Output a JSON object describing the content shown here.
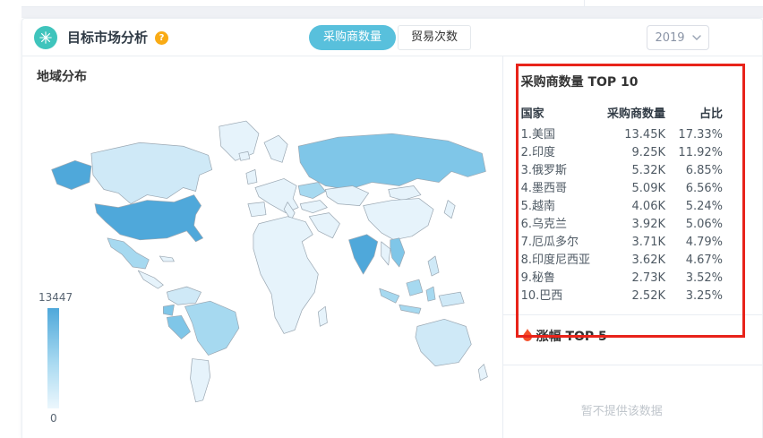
{
  "colors": {
    "icon_teal": "#3fc4bc",
    "tab_active_bg": "#58c0dc",
    "help_icon_bg": "#f9ab15",
    "flame": "#f4502a",
    "annotation_red": "#e8231a"
  },
  "map_colors": {
    "v0": "#e6f3fb",
    "v1": "#cfe9f7",
    "v2": "#a6d9f0",
    "v3": "#7fc6e8",
    "v4": "#4fa8da"
  },
  "header": {
    "title": "目标市场分析",
    "help_glyph": "?",
    "tabs": [
      {
        "label": "采购商数量"
      },
      {
        "label": "贸易次数"
      }
    ],
    "year": "2019"
  },
  "map_panel": {
    "title": "地域分布",
    "legend_max": "13447",
    "legend_min": "0"
  },
  "right_panel": {
    "top10_title": "采购商数量 TOP 10",
    "columns": {
      "country": "国家",
      "count": "采购商数量",
      "share": "占比"
    },
    "rows": [
      {
        "name": "1.美国",
        "count": "13.45K",
        "share": "17.33%"
      },
      {
        "name": "2.印度",
        "count": "9.25K",
        "share": "11.92%"
      },
      {
        "name": "3.俄罗斯",
        "count": "5.32K",
        "share": "6.85%"
      },
      {
        "name": "4.墨西哥",
        "count": "5.09K",
        "share": "6.56%"
      },
      {
        "name": "5.越南",
        "count": "4.06K",
        "share": "5.24%"
      },
      {
        "name": "6.乌克兰",
        "count": "3.92K",
        "share": "5.06%"
      },
      {
        "name": "7.厄瓜多尔",
        "count": "3.71K",
        "share": "4.79%"
      },
      {
        "name": "8.印度尼西亚",
        "count": "3.62K",
        "share": "4.67%"
      },
      {
        "name": "9.秘鲁",
        "count": "2.73K",
        "share": "3.52%"
      },
      {
        "name": "10.巴西",
        "count": "2.52K",
        "share": "3.25%"
      }
    ],
    "gains_title": "涨幅 TOP 5",
    "empty_text": "暂不提供该数据"
  },
  "chart_data": {
    "type": "choropleth-map",
    "title": "地域分布",
    "metric": "采购商数量",
    "year": "2019",
    "legend_range": [
      0,
      13447
    ],
    "legend_position": "bottom-left",
    "series": [
      {
        "country": "美国",
        "value": 13447,
        "count_label": "13.45K",
        "share": "17.33%"
      },
      {
        "country": "印度",
        "value": 9250,
        "count_label": "9.25K",
        "share": "11.92%"
      },
      {
        "country": "俄罗斯",
        "value": 5320,
        "count_label": "5.32K",
        "share": "6.85%"
      },
      {
        "country": "墨西哥",
        "value": 5090,
        "count_label": "5.09K",
        "share": "6.56%"
      },
      {
        "country": "越南",
        "value": 4060,
        "count_label": "4.06K",
        "share": "5.24%"
      },
      {
        "country": "乌克兰",
        "value": 3920,
        "count_label": "3.92K",
        "share": "5.06%"
      },
      {
        "country": "厄瓜多尔",
        "value": 3710,
        "count_label": "3.71K",
        "share": "4.79%"
      },
      {
        "country": "印度尼西亚",
        "value": 3620,
        "count_label": "3.62K",
        "share": "4.67%"
      },
      {
        "country": "秘鲁",
        "value": 2730,
        "count_label": "2.73K",
        "share": "3.52%"
      },
      {
        "country": "巴西",
        "value": 2520,
        "count_label": "2.52K",
        "share": "3.25%"
      }
    ]
  }
}
